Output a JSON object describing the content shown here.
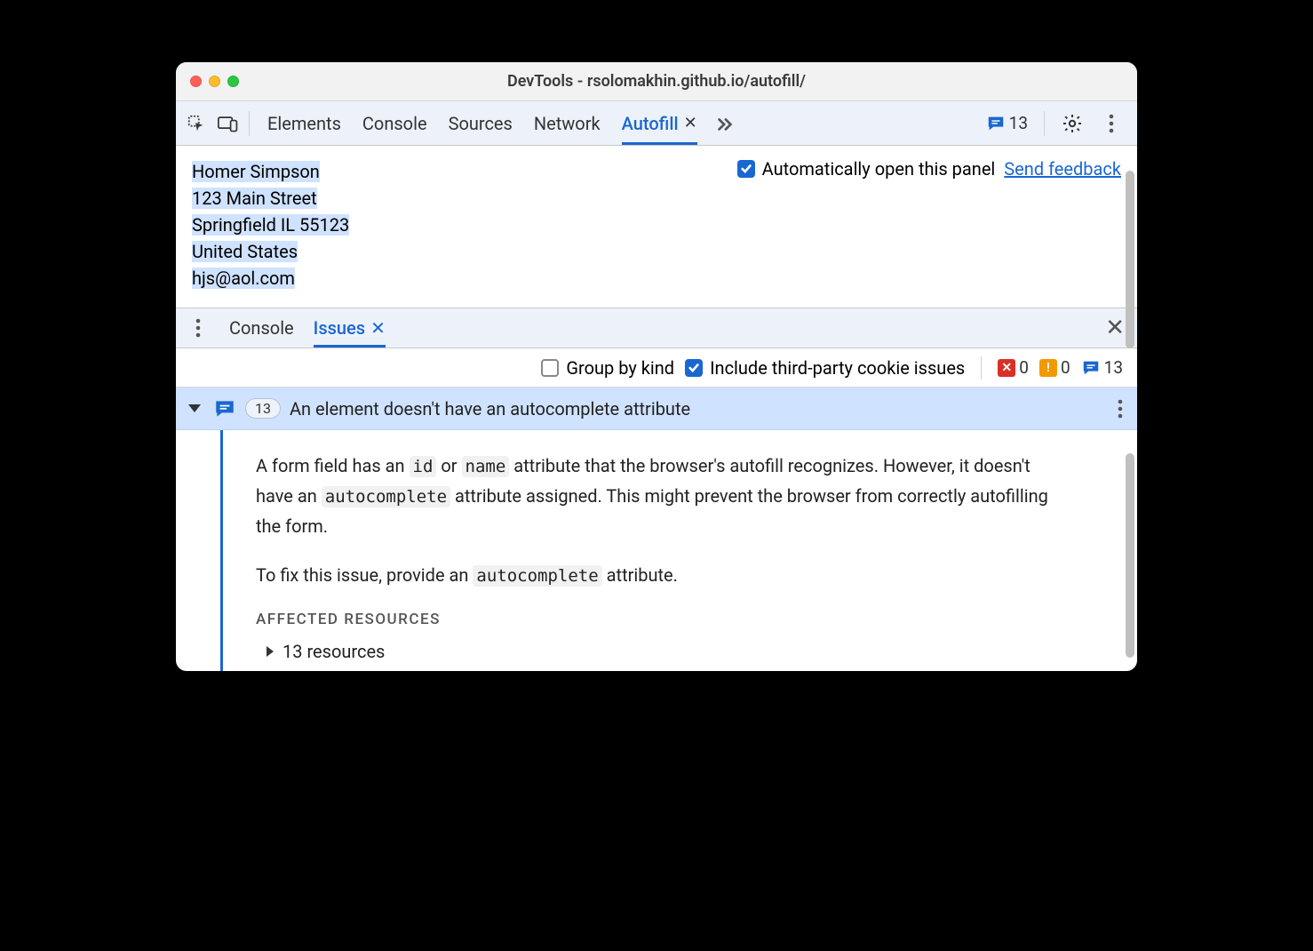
{
  "window": {
    "title": "DevTools - rsolomakhin.github.io/autofill/"
  },
  "tabbar": {
    "tabs": [
      "Elements",
      "Console",
      "Sources",
      "Network",
      "Autofill"
    ],
    "active_index": 4,
    "issues_count": "13"
  },
  "autofill_panel": {
    "address": {
      "name": "Homer Simpson",
      "street": "123 Main Street",
      "city_state_zip": "Springfield IL 55123",
      "country": "United States",
      "email": "hjs@aol.com"
    },
    "auto_open_label": "Automatically open this panel",
    "auto_open_checked": true,
    "feedback_label": "Send feedback"
  },
  "drawer": {
    "tabs": [
      "Console",
      "Issues"
    ],
    "active_index": 1
  },
  "issues_filters": {
    "group_by_kind_label": "Group by kind",
    "group_by_kind_checked": false,
    "third_party_label": "Include third-party cookie issues",
    "third_party_checked": true,
    "counts": {
      "errors": "0",
      "warnings": "0",
      "info": "13"
    }
  },
  "issue": {
    "count": "13",
    "title": "An element doesn't have an autocomplete attribute",
    "para1_pre": "A form field has an ",
    "code_id": "id",
    "para1_mid": " or ",
    "code_name": "name",
    "para1_mid2": " attribute that the browser's autofill recognizes. However, it doesn't have an ",
    "code_ac1": "autocomplete",
    "para1_post": " attribute assigned. This might prevent the browser from correctly autofilling the form.",
    "para2_pre": "To fix this issue, provide an ",
    "code_ac2": "autocomplete",
    "para2_post": " attribute.",
    "section_label": "AFFECTED RESOURCES",
    "resources_label": "13 resources"
  }
}
